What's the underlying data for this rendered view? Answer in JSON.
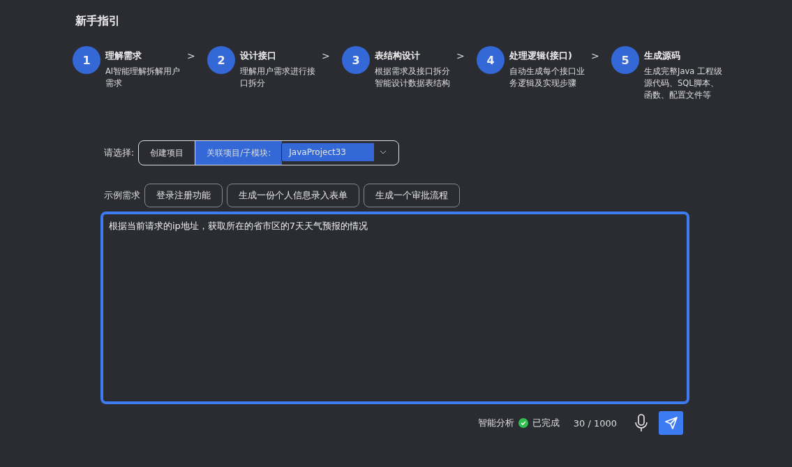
{
  "title": "新手指引",
  "steps": [
    {
      "number": "1",
      "title": "理解需求",
      "description": "AI智能理解拆解用户需求",
      "separator": ">"
    },
    {
      "number": "2",
      "title": "设计接口",
      "description": "理解用户需求进行接口拆分",
      "separator": ">"
    },
    {
      "number": "3",
      "title": "表结构设计",
      "description": "根据需求及接口拆分智能设计数据表结构",
      "separator": ">"
    },
    {
      "number": "4",
      "title": "处理逻辑(接口)",
      "description": "自动生成每个接口业务逻辑及实现步骤",
      "separator": ">"
    },
    {
      "number": "5",
      "title": "生成源码",
      "description": "生成完整Java 工程级源代码、SQL脚本、函数、配置文件等"
    }
  ],
  "select_label": "请选择:",
  "modes": [
    {
      "label": "创建项目",
      "selected": false
    },
    {
      "label": "关联项目/子模块:",
      "selected": true
    }
  ],
  "project_dropdown": {
    "value": "JavaProject33"
  },
  "examples_label": "示例需求",
  "examples": [
    "登录注册功能",
    "生成一份个人信息录入表单",
    "生成一个审批流程"
  ],
  "prompt": {
    "value": "根据当前请求的ip地址，获取所在的省市区的7天天气预报的情况"
  },
  "footer": {
    "analysis_label": "智能分析",
    "status": {
      "text": "已完成",
      "done": true
    },
    "counter": "30 / 1000"
  }
}
